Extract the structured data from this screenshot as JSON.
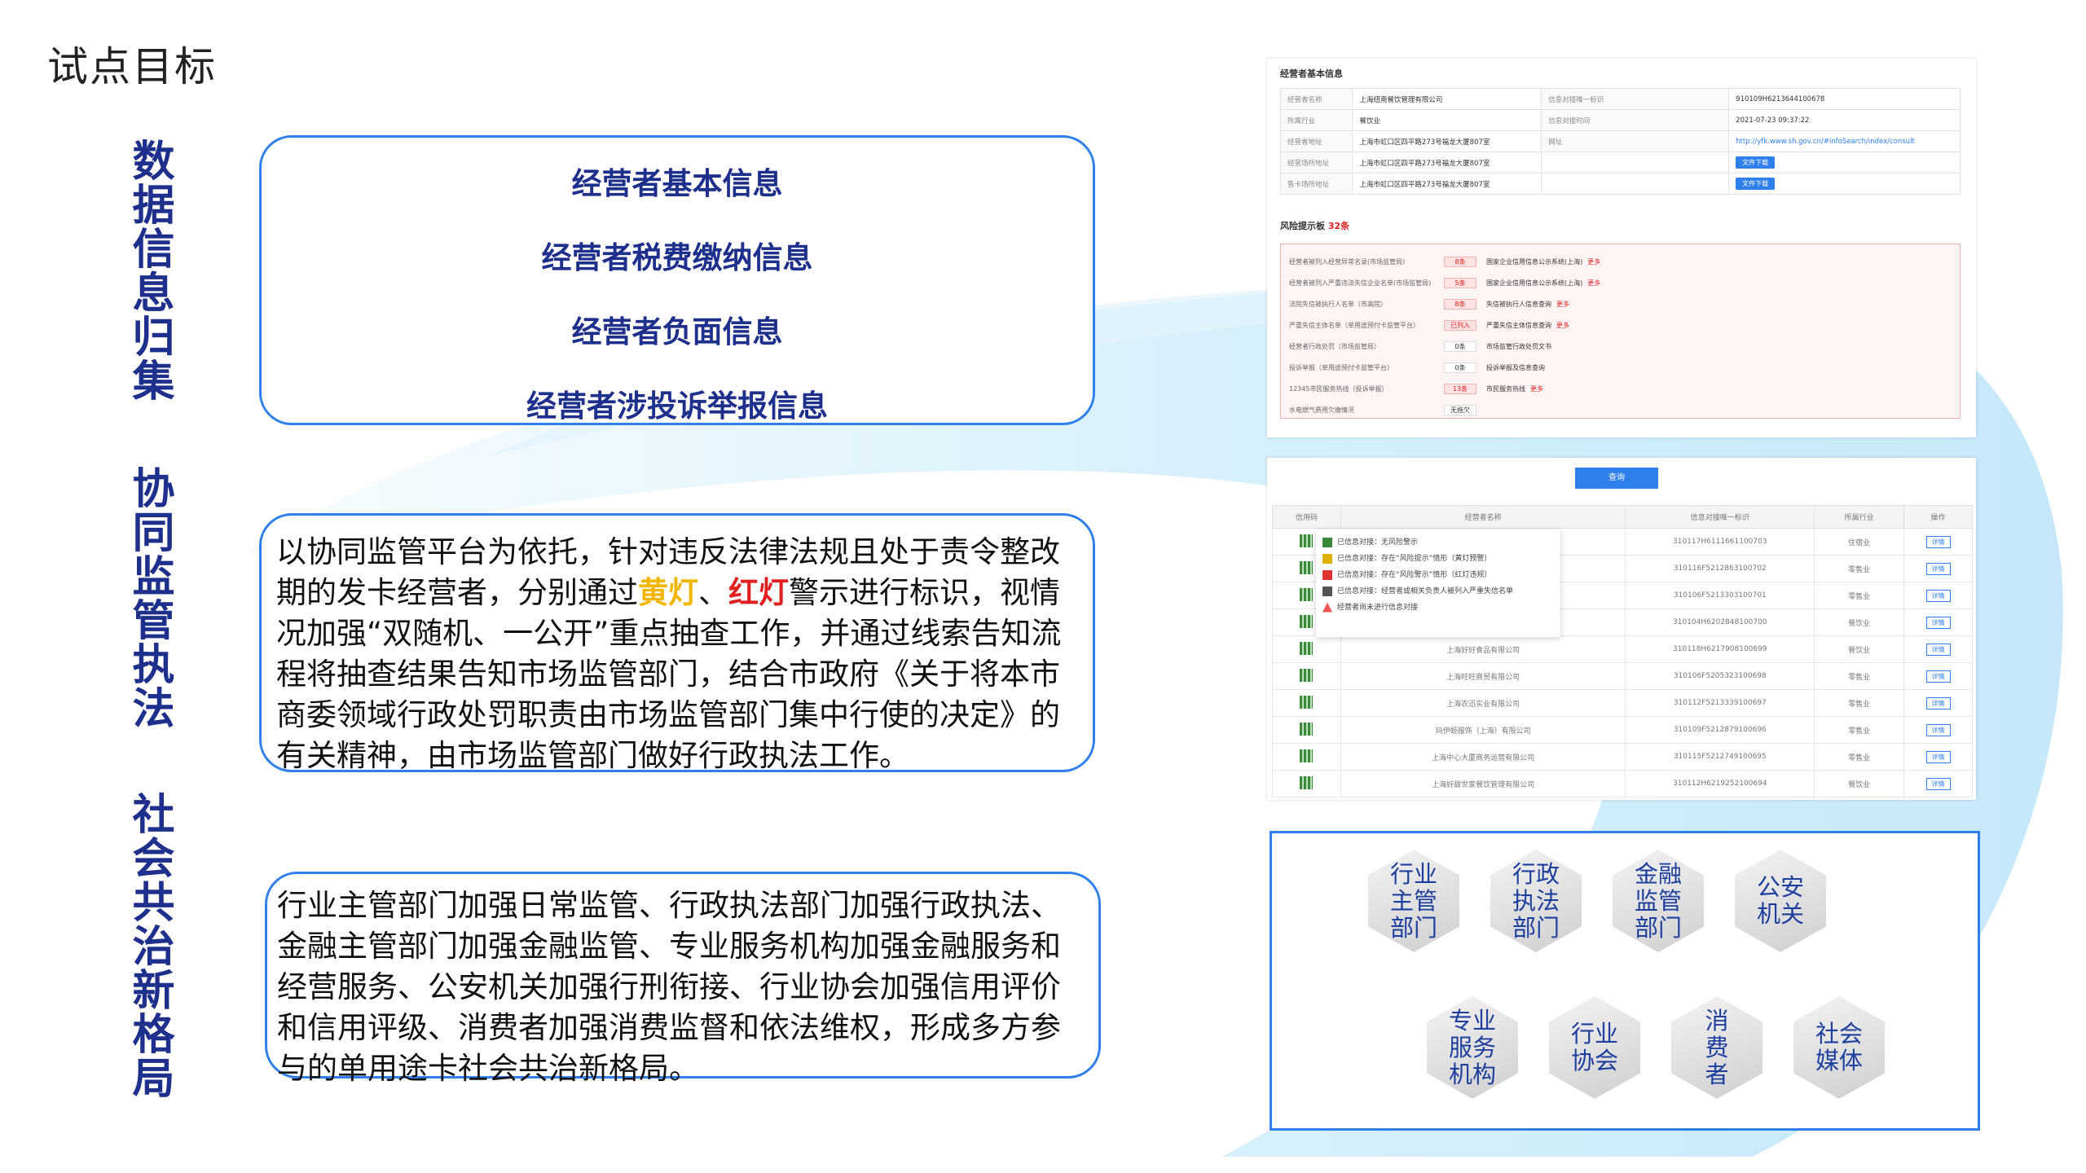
{
  "title": "试点目标",
  "side_headings": [
    "数据信息归集",
    "协同监管执法",
    "社会共治新格局"
  ],
  "data_items": [
    "经营者基本信息",
    "经营者税费缴纳信息",
    "经营者负面信息",
    "经营者涉投诉举报信息"
  ],
  "enforcement_text": {
    "part1": "以协同监管平台为依托，针对违反法律法规且处于责令整改期的发卡经营者，分别通过",
    "yellow_light": "黄灯",
    "sep": "、",
    "red_light": "红灯",
    "part2": "警示进行标识，视情况加强“双随机、一公开”重点抽查工作，并通过线索告知流程将抽查结果告知市场监管部门，结合市政府《关于将本市商委领域行政处罚职责由市场监管部门集中行使的决定》的有关精神，由市场监管部门做好行政执法工作。"
  },
  "governance_text": "行业主管部门加强日常监管、行政执法部门加强行政执法、金融主管部门加强金融监管、专业服务机构加强金融服务和经营服务、公安机关加强行刑衔接、行业协会加强信用评价和信用评级、消费者加强消费监督和依法维权，形成多方参与的单用途卡社会共治新格局。",
  "basic_info": {
    "header": "经营者基本信息",
    "rows": [
      [
        "经营者名称",
        "上海纽南餐饮管理有限公司",
        "信息对接唯一标识",
        "910109H6213644100678"
      ],
      [
        "所属行业",
        "餐饮业",
        "信息对接时间",
        "2021-07-23 09:37:22"
      ],
      [
        "经营者地址",
        "上海市虹口区四平路273号福龙大厦807室",
        "网址",
        "http://yfk.www.sh.gov.cn/#infoSearch/index/consult"
      ],
      [
        "经营场所地址",
        "上海市虹口区四平路273号福龙大厦807室",
        "",
        "文件下载"
      ],
      [
        "售卡场所地址",
        "上海市虹口区四平路273号福龙大厦807室",
        "",
        "文件下载"
      ]
    ]
  },
  "risk": {
    "header": "风险提示板",
    "count": "32条",
    "rows": [
      [
        "经营者被列入经营异常名录(市场监管局)",
        "8条",
        "国家企业信用信息公示系统(上海)",
        "更多"
      ],
      [
        "经营者被列入严重违法失信企业名单(市场监管局)",
        "5条",
        "国家企业信用信息公示系统(上海)",
        "更多"
      ],
      [
        "法院失信被执行人名单（市高院）",
        "8条",
        "失信被执行人信息查询",
        "更多"
      ],
      [
        "严重失信主体名单（单用途预付卡监管平台）",
        "已列入",
        "严重失信主体信息查询",
        "更多"
      ],
      [
        "经营者行政处罚（市场监管局）",
        "0条",
        "市场监管行政处罚文书",
        ""
      ],
      [
        "投诉举报（单用途预付卡监管平台）",
        "0条",
        "投诉举报及信息查询",
        ""
      ],
      [
        "12345市民服务热线（投诉举报）",
        "13条",
        "市民服务热线",
        "更多"
      ],
      [
        "水电燃气费用欠缴情况",
        "无拖欠",
        "",
        ""
      ]
    ]
  },
  "list": {
    "search_label": "查询",
    "headers": [
      "信用码",
      "经营者名称",
      "信息对接唯一标识",
      "所属行业",
      "操作"
    ],
    "detail_label": "详情",
    "rows": [
      [
        "",
        "310117H6111661100703",
        "住宿业"
      ],
      [
        "",
        "310116F5212863100702",
        "零售业"
      ],
      [
        "",
        "310106F5213303100701",
        "零售业"
      ],
      [
        "",
        "310104H6202848100700",
        "餐饮业"
      ],
      [
        "上海好好食品有限公司",
        "310118H6217908100699",
        "餐饮业"
      ],
      [
        "上海旺旺商贸有限公司",
        "310106F5205323100698",
        "零售业"
      ],
      [
        "上海农迅实业有限公司",
        "310112F5213339100697",
        "零售业"
      ],
      [
        "玛伊姬服饰（上海）有限公司",
        "310109F5212879100696",
        "零售业"
      ],
      [
        "上海中心大厦商务运营有限公司",
        "310115F5212749100695",
        "零售业"
      ],
      [
        "上海好甜世家餐饮管理有限公司",
        "310112H6219252100694",
        "餐饮业"
      ]
    ],
    "popover": [
      "已信息对接：无风险警示",
      "已信息对接：存在“风险提示”情形（黄灯预警）",
      "已信息对接：存在“风险警示”情形（红灯违规）",
      "已信息对接：经营者或相关负责人被列入严重失信名单",
      "经营者尚未进行信息对接"
    ]
  },
  "parties": [
    "行业\n主管\n部门",
    "行政\n执法\n部门",
    "金融\n监管\n部门",
    "公安\n机关",
    "专业\n服务\n机构",
    "行业\n协会",
    "消\n费\n者",
    "社会\n媒体"
  ]
}
